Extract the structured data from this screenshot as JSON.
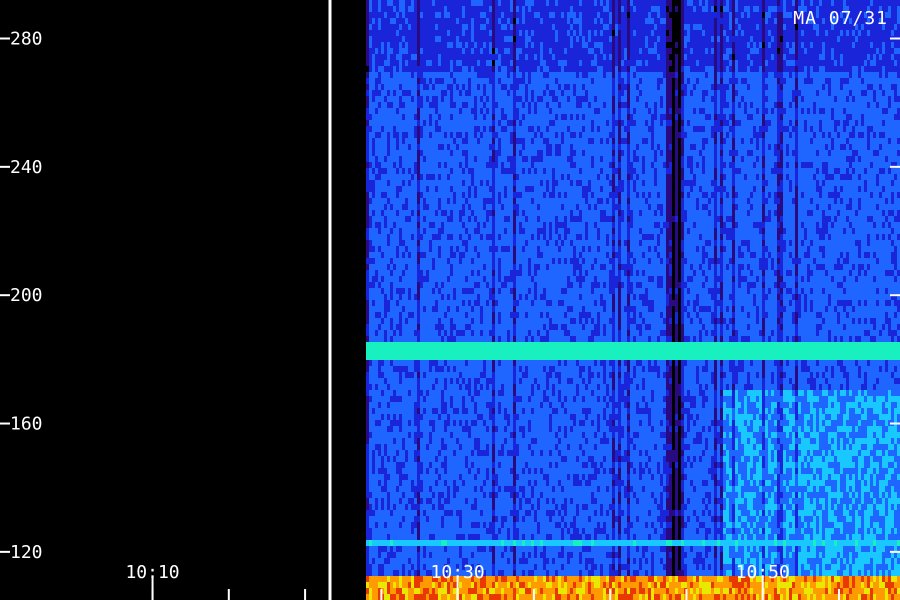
{
  "chart_data": {
    "type": "heatmap",
    "title": "MA 07/31",
    "xlabel": "",
    "ylabel": "",
    "y_ticks": [
      280,
      240,
      200,
      160,
      120
    ],
    "x_ticks": [
      "10:10",
      "10:30",
      "10:50"
    ],
    "ylim": [
      105,
      292
    ],
    "x_range": [
      "10:00",
      "10:59"
    ],
    "data_start": "10:24",
    "gap_marker": "10:21",
    "colormap": [
      "#000000",
      "#2a0a80",
      "#1a24d8",
      "#1e66ff",
      "#18c8ff",
      "#18f0c0",
      "#e8e800",
      "#ff9a00",
      "#e83a00"
    ],
    "bands": [
      {
        "y_low": 180,
        "y_high": 186,
        "intensity": "high",
        "note": "continuous horizontal line"
      },
      {
        "y_low": 122,
        "y_high": 124,
        "intensity": "medium"
      },
      {
        "y_low": 105,
        "y_high": 112,
        "intensity": "very-high"
      }
    ],
    "dropout_time": "10:44",
    "grid": false
  }
}
